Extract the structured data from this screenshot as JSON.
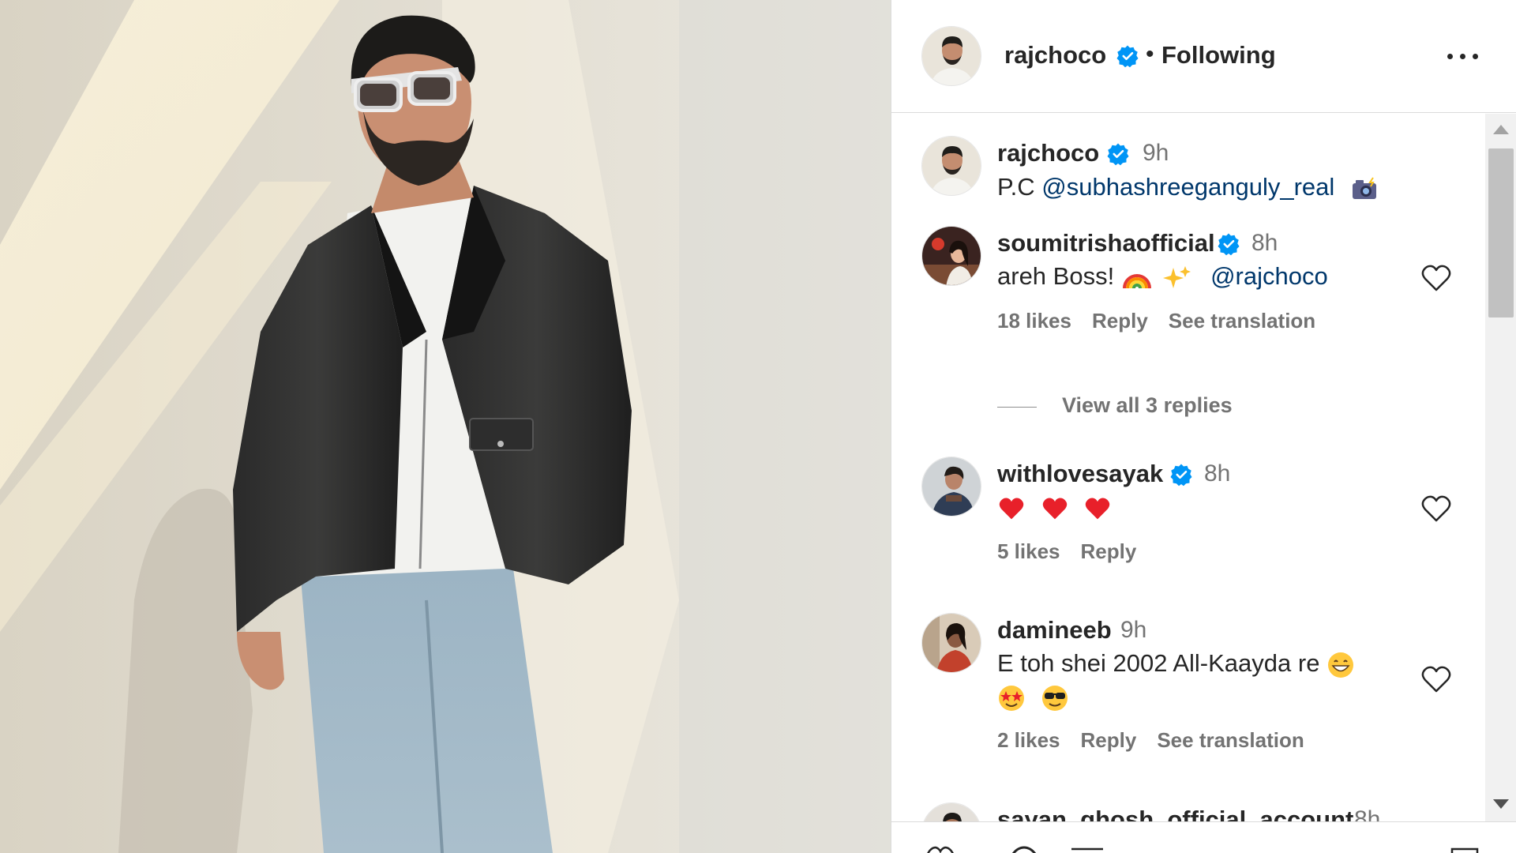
{
  "post": {
    "author": "rajchoco",
    "separator": "•",
    "follow_status": "Following",
    "more_icon": "more-horizontal-icon"
  },
  "caption": {
    "username": "rajchoco",
    "time": "9h",
    "text_prefix": "P.C ",
    "mention": "@subhashreeganguly_real",
    "emoji": "camera-flash-emoji"
  },
  "comments": [
    {
      "username": "soumitrishaofficial",
      "verified": true,
      "time": "8h",
      "text": "areh Boss! ",
      "emojis": [
        "rainbow-emoji",
        "sparkles-emoji"
      ],
      "mention": "@rajchoco",
      "likes": "18 likes",
      "reply": "Reply",
      "translate": "See translation",
      "view_replies": "View all 3 replies"
    },
    {
      "username": "withlovesayak",
      "verified": true,
      "time": "8h",
      "emojis": [
        "red-heart-emoji",
        "red-heart-emoji",
        "red-heart-emoji"
      ],
      "likes": "5 likes",
      "reply": "Reply"
    },
    {
      "username": "damineeb",
      "verified": false,
      "time": "9h",
      "text": "E toh shei 2002 All-Kaayda re ",
      "emojis": [
        "grinning-emoji",
        "star-struck-emoji",
        "sunglasses-emoji"
      ],
      "likes": "2 likes",
      "reply": "Reply",
      "translate": "See translation"
    },
    {
      "username": "sayan_ghosh_official_account",
      "time": "8h"
    }
  ],
  "colors": {
    "verified_blue": "#0095f6",
    "mention_blue": "#00376b",
    "secondary_text": "#737373",
    "heart_red": "#e8202a"
  }
}
